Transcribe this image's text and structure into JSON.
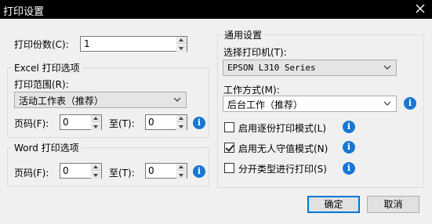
{
  "window": {
    "title": "打印设置"
  },
  "copies": {
    "label": "打印份数(C):",
    "value": "1"
  },
  "excel": {
    "group_title": "Excel 打印选项",
    "range_label": "打印范围(R):",
    "range_value": "活动工作表（推荐）",
    "page_from_label": "页码(F):",
    "page_from_value": "0",
    "page_to_label": "至(T):",
    "page_to_value": "0"
  },
  "word": {
    "group_title": "Word 打印选项",
    "page_from_label": "页码(F):",
    "page_from_value": "0",
    "page_to_label": "至(T):",
    "page_to_value": "0"
  },
  "general": {
    "group_title": "通用设置",
    "printer_label": "选择打印机(T):",
    "printer_value": "EPSON L310 Series",
    "mode_label": "工作方式(M):",
    "mode_value": "后台工作（推荐）",
    "options": [
      {
        "label": "启用逐份打印模式(L)",
        "checked": false
      },
      {
        "label": "启用无人守值模式(N)",
        "checked": true
      },
      {
        "label": "分开类型进行打印(S)",
        "checked": false
      }
    ]
  },
  "buttons": {
    "ok": "确定",
    "cancel": "取消"
  },
  "info_glyph": "i",
  "colors": {
    "titlebar": "#000000",
    "info": "#1976d2",
    "default_button_border": "#0078d7"
  }
}
